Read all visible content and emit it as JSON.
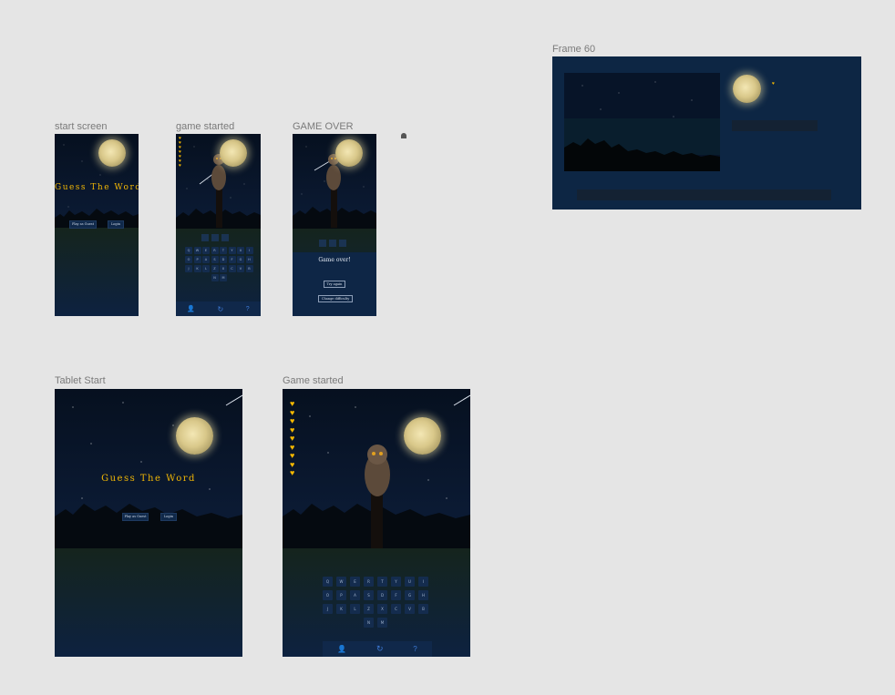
{
  "frames": {
    "start": {
      "label": "start screen",
      "title": "Guess The Word",
      "play_guest": "Play as Guest",
      "login": "Login"
    },
    "game_started": {
      "label": "game started"
    },
    "game_over": {
      "label": "GAME OVER",
      "message": "Game over!",
      "try_again": "Try again",
      "change_difficulty": "Change difficulty"
    },
    "frame60": {
      "label": "Frame 60"
    },
    "tablet_start": {
      "label": "Tablet Start",
      "title": "Guess The Word",
      "play_guest": "Play as Guest",
      "login": "Login"
    },
    "tablet_game": {
      "label": "Game started"
    }
  },
  "keyboard_rows": [
    [
      "Q",
      "W",
      "E",
      "R",
      "T",
      "Y",
      "U",
      "I"
    ],
    [
      "O",
      "P",
      "A",
      "S",
      "D",
      "F",
      "G",
      "H"
    ],
    [
      "J",
      "K",
      "L",
      "Z",
      "X",
      "C",
      "V",
      "B"
    ],
    [
      "N",
      "M"
    ]
  ],
  "hearts_count": 9,
  "nav_icons": [
    "user-icon",
    "restart-icon",
    "help-icon"
  ],
  "colors": {
    "accent": "#f2b705",
    "night": "#0b1a33",
    "button": "#10294a",
    "heart": "#f5b800",
    "nav_icon": "#3d7ad6"
  }
}
